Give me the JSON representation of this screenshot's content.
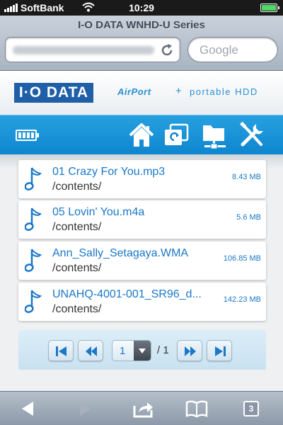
{
  "status": {
    "carrier": "SoftBank",
    "time": "10:29"
  },
  "browser": {
    "page_title": "I-O DATA WNHD-U Series",
    "search_placeholder": "Google"
  },
  "brand": {
    "logo": "I·O DATA",
    "airport": "AirPort",
    "plus": "+",
    "tagline": "portable HDD"
  },
  "toolbar": {
    "icons": [
      "battery-icon",
      "home-icon",
      "sync-icon",
      "network-folder-icon",
      "tools-icon"
    ]
  },
  "files": [
    {
      "name": "01 Crazy For You.mp3",
      "path": "/contents/",
      "size": "8.43 MB"
    },
    {
      "name": "05 Lovin' You.m4a",
      "path": "/contents/",
      "size": "5.6 MB"
    },
    {
      "name": "Ann_Sally_Setagaya.WMA",
      "path": "/contents/",
      "size": "106.85 MB"
    },
    {
      "name": "UNAHQ-4001-001_SR96_d...",
      "path": "/contents/",
      "size": "142.23 MB"
    }
  ],
  "pager": {
    "current": "1",
    "total": "/ 1"
  },
  "bottom": {
    "tab_count": "3"
  },
  "colors": {
    "accent": "#0d86cf",
    "link": "#1a78c7",
    "brand": "#1f5fa8"
  }
}
